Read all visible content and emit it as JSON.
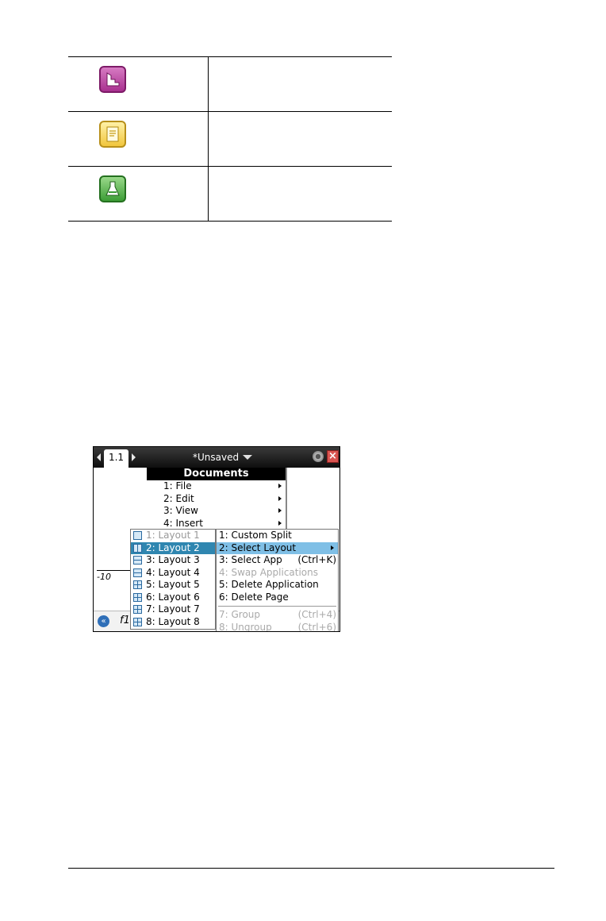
{
  "app_table": {
    "rows": [
      {
        "icon": "data-stats-icon",
        "color": "#a8308f"
      },
      {
        "icon": "notes-icon",
        "color": "#f1c63d"
      },
      {
        "icon": "vernier-dataquest-icon",
        "color": "#3c9d36"
      }
    ]
  },
  "screen": {
    "page_tab": "1.1",
    "doc_title": "*Unsaved",
    "axis_label": "-10",
    "bottom_label": "f1",
    "documents_menu": {
      "header": "Documents",
      "items": [
        "1: File",
        "2: Edit",
        "3: View",
        "4: Insert"
      ]
    },
    "page_menu": {
      "items": [
        {
          "label": "1: Custom Split",
          "shortcut": "",
          "selected": false,
          "disabled": false
        },
        {
          "label": "2: Select Layout",
          "shortcut": "",
          "selected": true,
          "disabled": false
        },
        {
          "label": "3: Select App",
          "shortcut": "(Ctrl+K)",
          "selected": false,
          "disabled": false
        },
        {
          "label": "4: Swap Applications",
          "shortcut": "",
          "selected": false,
          "disabled": true
        },
        {
          "label": "5: Delete Application",
          "shortcut": "",
          "selected": false,
          "disabled": false
        },
        {
          "label": "6: Delete Page",
          "shortcut": "",
          "selected": false,
          "disabled": false
        },
        {
          "label": "7: Group",
          "shortcut": "(Ctrl+4)",
          "selected": false,
          "disabled": true
        },
        {
          "label": "8: Ungroup",
          "shortcut": "(Ctrl+6)",
          "selected": false,
          "disabled": true
        }
      ]
    },
    "layout_menu": {
      "items": [
        {
          "label": "1: Layout 1",
          "selected": false,
          "disabled": true
        },
        {
          "label": "2: Layout 2",
          "selected": true,
          "disabled": false
        },
        {
          "label": "3: Layout 3",
          "selected": false,
          "disabled": false
        },
        {
          "label": "4: Layout 4",
          "selected": false,
          "disabled": false
        },
        {
          "label": "5: Layout 5",
          "selected": false,
          "disabled": false
        },
        {
          "label": "6: Layout 6",
          "selected": false,
          "disabled": false
        },
        {
          "label": "7: Layout 7",
          "selected": false,
          "disabled": false
        },
        {
          "label": "8: Layout 8",
          "selected": false,
          "disabled": false
        }
      ]
    }
  }
}
